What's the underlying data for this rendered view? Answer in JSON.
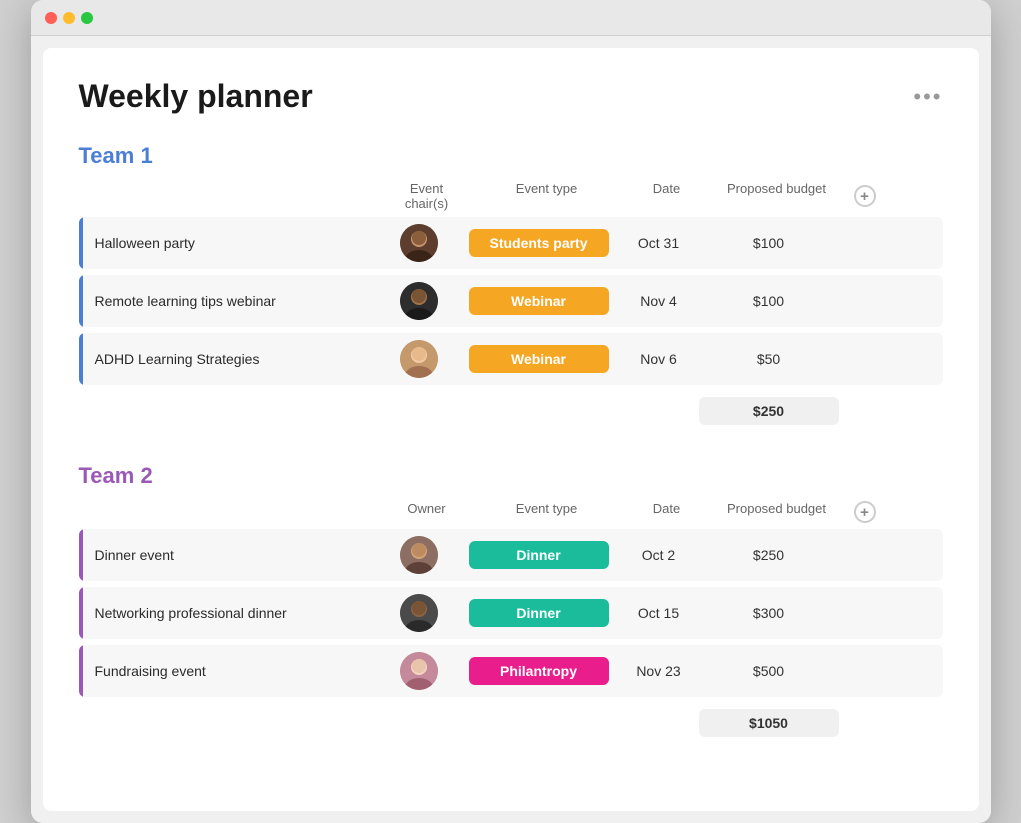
{
  "window": {
    "title": "Weekly planner"
  },
  "page": {
    "title": "Weekly planner",
    "more_icon": "•••"
  },
  "team1": {
    "name": "Team 1",
    "col_headers": {
      "event": "",
      "chair": "Event chair(s)",
      "type": "Event type",
      "date": "Date",
      "budget": "Proposed budget"
    },
    "rows": [
      {
        "name": "Halloween party",
        "avatar_label": "AV",
        "avatar_class": "av1",
        "type": "Students party",
        "type_class": "badge-students",
        "date": "Oct 31",
        "budget": "$100"
      },
      {
        "name": "Remote learning tips webinar",
        "avatar_label": "AV",
        "avatar_class": "av2",
        "type": "Webinar",
        "type_class": "badge-webinar",
        "date": "Nov 4",
        "budget": "$100"
      },
      {
        "name": "ADHD Learning Strategies",
        "avatar_label": "AV",
        "avatar_class": "av3",
        "type": "Webinar",
        "type_class": "badge-webinar",
        "date": "Nov 6",
        "budget": "$50"
      }
    ],
    "total": "$250"
  },
  "team2": {
    "name": "Team 2",
    "col_headers": {
      "event": "",
      "chair": "Owner",
      "type": "Event type",
      "date": "Date",
      "budget": "Proposed budget"
    },
    "rows": [
      {
        "name": "Dinner event",
        "avatar_label": "AV",
        "avatar_class": "av4",
        "type": "Dinner",
        "type_class": "badge-dinner",
        "date": "Oct 2",
        "budget": "$250"
      },
      {
        "name": "Networking professional dinner",
        "avatar_label": "AV",
        "avatar_class": "av5",
        "type": "Dinner",
        "type_class": "badge-dinner",
        "date": "Oct 15",
        "budget": "$300"
      },
      {
        "name": "Fundraising event",
        "avatar_label": "AV",
        "avatar_class": "av6",
        "type": "Philantropy",
        "type_class": "badge-philantropy",
        "date": "Nov 23",
        "budget": "$500"
      }
    ],
    "total": "$1050"
  }
}
